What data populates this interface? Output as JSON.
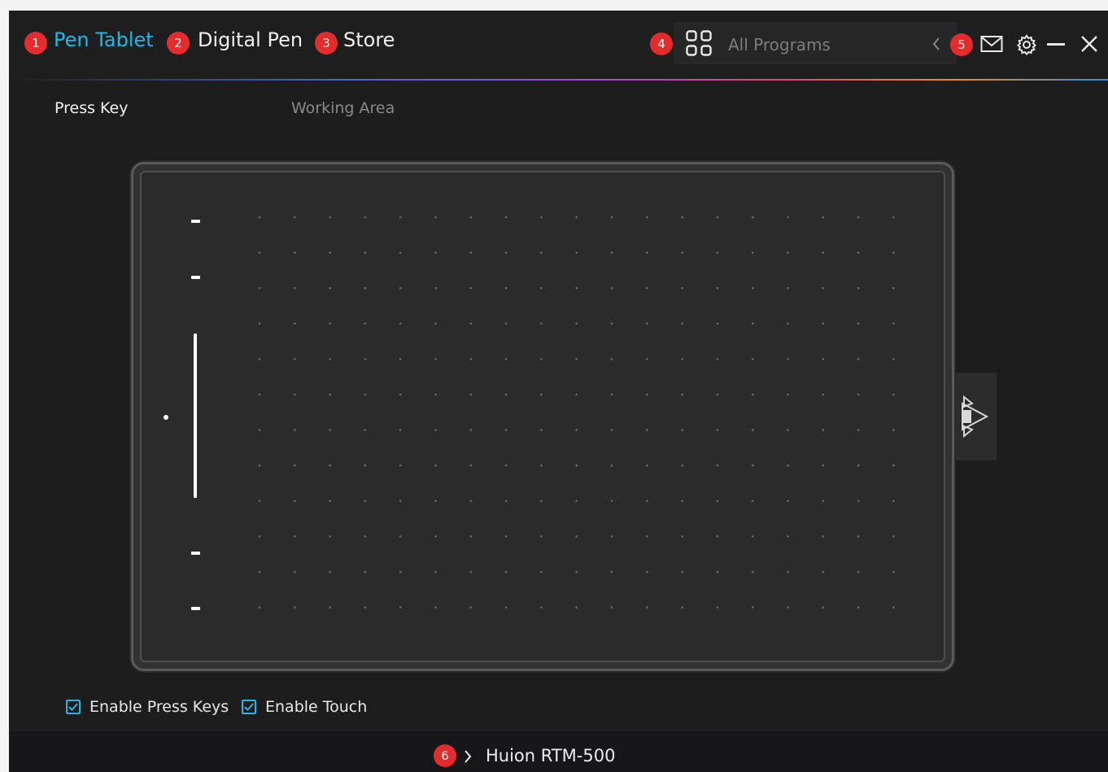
{
  "nav": {
    "tabs": [
      {
        "badge": "1",
        "label": "Pen Tablet",
        "active": true
      },
      {
        "badge": "2",
        "label": "Digital Pen",
        "active": false
      },
      {
        "badge": "3",
        "label": "Store",
        "active": false
      }
    ],
    "programs": {
      "badge": "4",
      "label": "All Programs",
      "icon": "grid-icon"
    },
    "window_badge": "5",
    "icons": [
      "chevron-left-icon",
      "mail-icon",
      "gear-icon",
      "minimize-icon",
      "close-icon"
    ]
  },
  "subtabs": {
    "press_key": "Press Key",
    "working_area": "Working Area"
  },
  "options": {
    "enable_press_keys": {
      "label": "Enable Press Keys",
      "checked": true
    },
    "enable_touch": {
      "label": "Enable Touch",
      "checked": true
    }
  },
  "footer": {
    "badge": "6",
    "device": "Huion RTM-500",
    "icon": "chevron-right-icon"
  },
  "colors": {
    "accent": "#22b6e6",
    "badge": "#e52c2c",
    "background": "#1d1d1e"
  }
}
